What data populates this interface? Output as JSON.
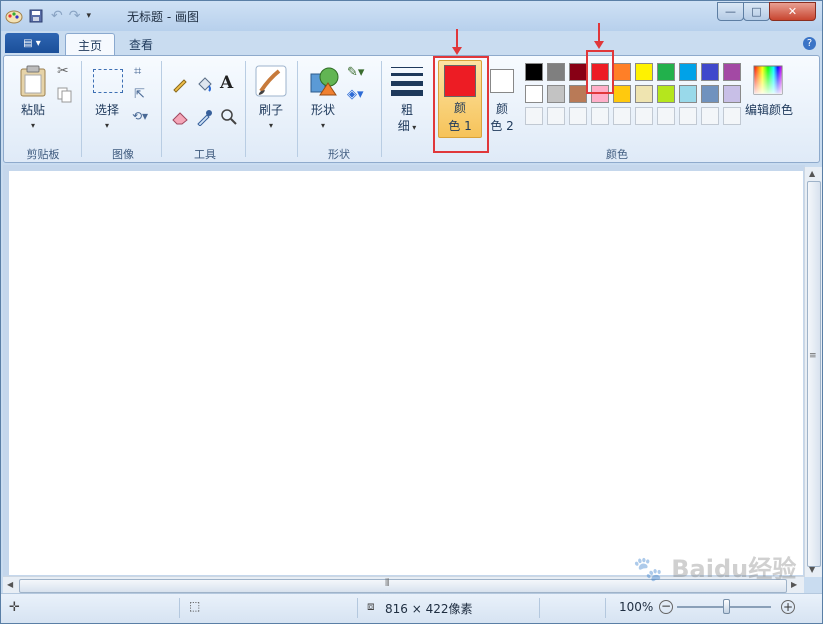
{
  "window": {
    "title": "无标题 - 画图",
    "minimize": "—",
    "maximize": "□",
    "close": "✕"
  },
  "tabs": [
    {
      "label": "主页"
    },
    {
      "label": "查看"
    }
  ],
  "groups": {
    "clipboard": {
      "label": "剪贴板",
      "paste": "粘贴"
    },
    "image": {
      "label": "图像",
      "select": "选择"
    },
    "tools": {
      "label": "工具",
      "text_tool": "A"
    },
    "brushes": {
      "label": "刷子"
    },
    "shapes": {
      "label": "形状",
      "shapes_button": "形状"
    },
    "size": {
      "label_line1": "粗",
      "label_line2": "细"
    },
    "colors": {
      "label": "颜色",
      "color1_line1": "颜",
      "color1_line2": "色 1",
      "color2_line1": "颜",
      "color2_line2": "色 2",
      "edit_colors": "编辑颜色",
      "color1_value": "#ed1c24",
      "color2_value": "#ffffff",
      "palette_row1": [
        "#000000",
        "#7f7f7f",
        "#880015",
        "#ed1c24",
        "#ff7f27",
        "#fff200",
        "#22b14c",
        "#00a2e8",
        "#3f48cc",
        "#a349a4"
      ],
      "palette_row2": [
        "#ffffff",
        "#c3c3c3",
        "#b97a57",
        "#ffaec9",
        "#ffc90e",
        "#efe4b0",
        "#b5e61d",
        "#99d9ea",
        "#7092be",
        "#c8bfe7"
      ]
    }
  },
  "status": {
    "canvas_size": "816 × 422像素",
    "zoom": "100%"
  },
  "watermark": "Baidu经验"
}
